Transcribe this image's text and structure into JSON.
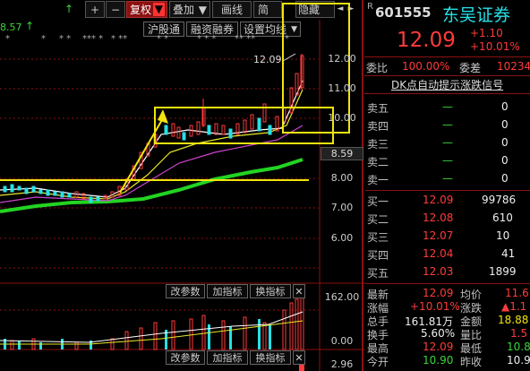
{
  "toolbar": {
    "up": "↑",
    "plus": "+",
    "minus": "−",
    "restore_rights": "复权",
    "overlay": "叠加",
    "draw_line": "画线",
    "simple": "简",
    "hide": "隐藏",
    "prev": "◄",
    "next": "►"
  },
  "chart_top": {
    "price_tag": "8.57",
    "up_arrow": "↑",
    "hgt_button": "沪股通",
    "margin_button": "融资融券",
    "ma_settings": "设置均线",
    "max_price_label": "12.09"
  },
  "price_axis": [
    "12.00",
    "11.00",
    "10.00",
    "8.59",
    "8.00",
    "7.00",
    "6.00"
  ],
  "volume_panel": {
    "modify_params": "改参数",
    "add_indicator": "加指标",
    "switch_indicator": "换指标",
    "close": "✕",
    "axis_top": "162.00",
    "axis_bottom": "0.00"
  },
  "bottom_panel": {
    "modify_params": "改参数",
    "add_indicator": "加指标",
    "switch_indicator": "换指标",
    "close": "✕",
    "axis_value": "2.96"
  },
  "stock": {
    "letter": "R",
    "code": "601555",
    "name": "东吴证券",
    "price": "12.09",
    "change": "+1.10",
    "change_pct": "+10.01%",
    "wei_bi_label": "委比",
    "wei_bi_value": "100.00%",
    "wei_cha_label": "委差",
    "wei_cha_value": "10234",
    "signal": "DK点自动提示涨跌信号"
  },
  "asks": [
    {
      "label": "卖五",
      "price": "—",
      "vol": "0"
    },
    {
      "label": "卖四",
      "price": "—",
      "vol": "0"
    },
    {
      "label": "卖三",
      "price": "—",
      "vol": "0"
    },
    {
      "label": "卖二",
      "price": "—",
      "vol": "0"
    },
    {
      "label": "卖一",
      "price": "—",
      "vol": "0"
    }
  ],
  "bids": [
    {
      "label": "买一",
      "price": "12.09",
      "vol": "99786"
    },
    {
      "label": "买二",
      "price": "12.08",
      "vol": "610"
    },
    {
      "label": "买三",
      "price": "12.07",
      "vol": "10"
    },
    {
      "label": "买四",
      "price": "12.04",
      "vol": "41"
    },
    {
      "label": "买五",
      "price": "12.03",
      "vol": "1899"
    }
  ],
  "quote": [
    {
      "l1": "最新",
      "v1": "12.09",
      "l2": "均价",
      "v2": "11.6"
    },
    {
      "l1": "涨幅",
      "v1": "+10.01%",
      "l2": "涨跌",
      "v2": "▲1.1"
    },
    {
      "l1": "总手",
      "v1": "161.81万",
      "l2": "金额",
      "v2": "18.88"
    },
    {
      "l1": "换手",
      "v1": "5.60%",
      "l2": "量比",
      "v2": "1.5"
    },
    {
      "l1": "最高",
      "v1": "12.09",
      "l2": "最低",
      "v2": "10.8"
    },
    {
      "l1": "今开",
      "v1": "10.90",
      "l2": "昨收",
      "v2": "10.9"
    }
  ],
  "colors": {
    "up": "#ff3b3b",
    "down": "#3bd43b",
    "annotation": "#f2e40e",
    "cyan_candle": "#27e0e6"
  }
}
